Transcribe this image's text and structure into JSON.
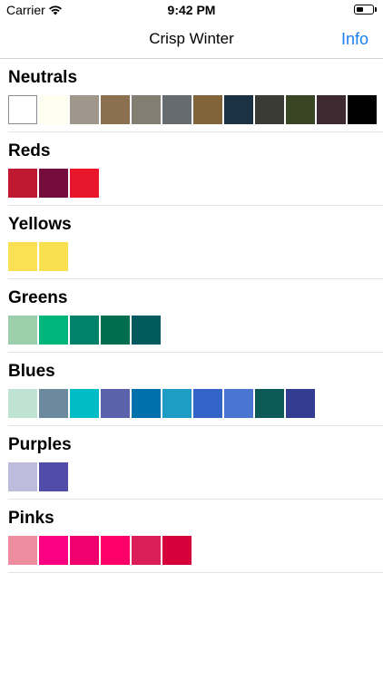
{
  "status_bar": {
    "carrier": "Carrier",
    "time": "9:42 PM",
    "battery_level": 0.45
  },
  "nav": {
    "title": "Crisp Winter",
    "info_label": "Info"
  },
  "sections": [
    {
      "name": "Neutrals",
      "colors": [
        "#ffffff",
        "#fdfdf0",
        "#a0978c",
        "#8b6f4e",
        "#847e72",
        "#656b6e",
        "#81643a",
        "#1b3244",
        "#3b3b35",
        "#394624",
        "#3f2931",
        "#000000"
      ]
    },
    {
      "name": "Reds",
      "colors": [
        "#bf1932",
        "#740d3b",
        "#e8172b"
      ]
    },
    {
      "name": "Yellows",
      "colors": [
        "#fbe053",
        "#f8e04e"
      ]
    },
    {
      "name": "Greens",
      "colors": [
        "#9ecfac",
        "#00b67a",
        "#00836a",
        "#006c50",
        "#005a5e"
      ]
    },
    {
      "name": "Blues",
      "colors": [
        "#bfe3d3",
        "#6b8a9e",
        "#00bcc4",
        "#5a62ab",
        "#0070ad",
        "#1e9cc3",
        "#3464c8",
        "#4a76d2",
        "#0b5a58",
        "#343c91"
      ]
    },
    {
      "name": "Purples",
      "colors": [
        "#bdbcdd",
        "#514ca8"
      ]
    },
    {
      "name": "Pinks",
      "colors": [
        "#ee8ca0",
        "#fb0080",
        "#f0006e",
        "#fc0068",
        "#db1d58",
        "#d6003a"
      ]
    }
  ]
}
